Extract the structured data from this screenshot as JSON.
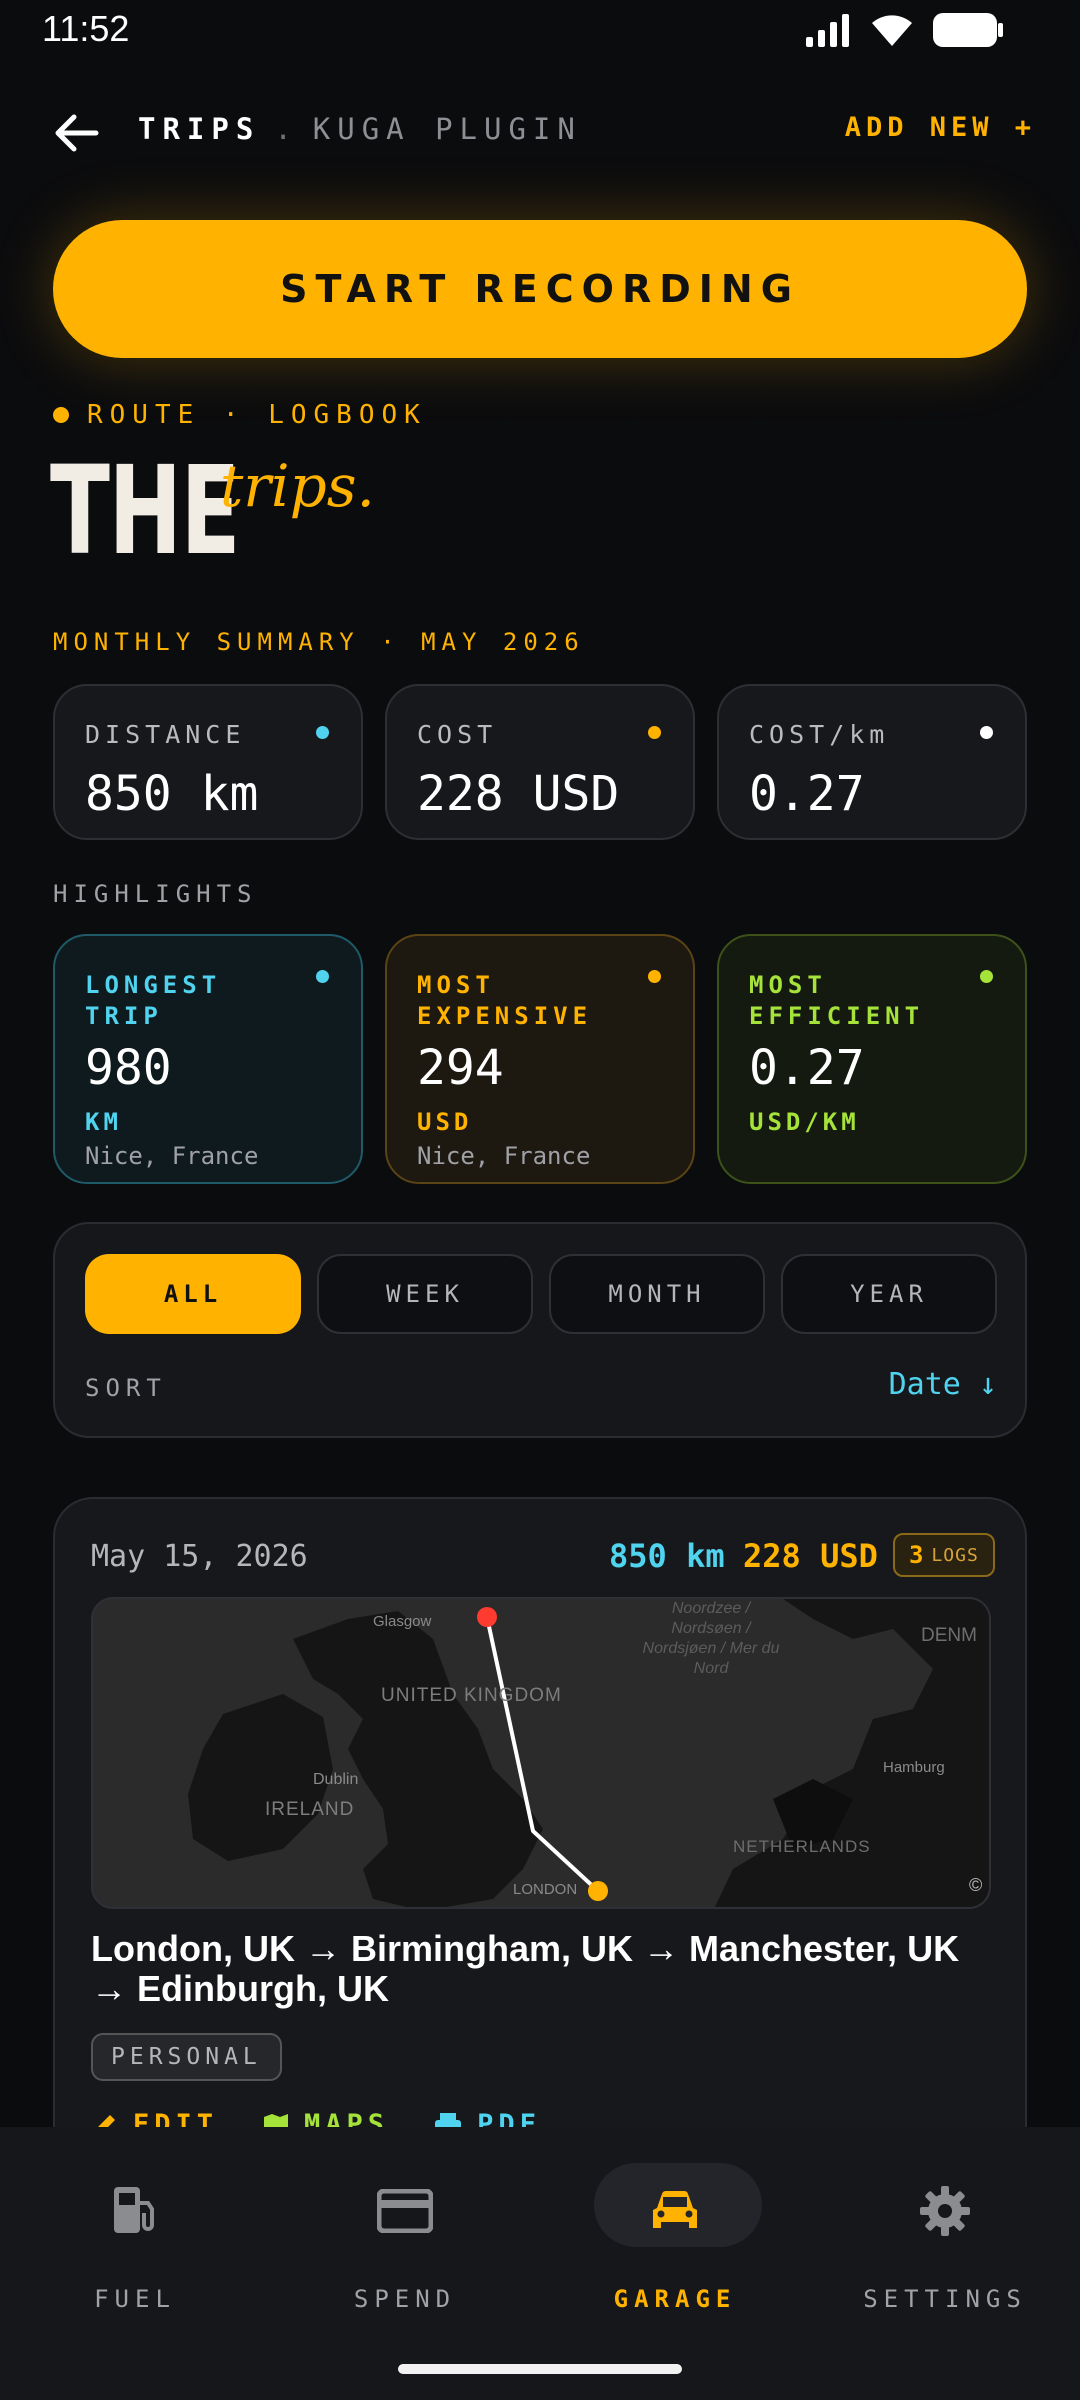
{
  "status": {
    "time": "11:52"
  },
  "header": {
    "title": "TRIPS",
    "separator": ".",
    "subtitle": "KUGA PLUGIN",
    "add_new": "ADD NEW +"
  },
  "start_button": "START RECORDING",
  "kicker": "ROUTE · LOGBOOK",
  "heading": {
    "big": "THE",
    "script": "trips."
  },
  "monthly_label": "MONTHLY SUMMARY · MAY 2026",
  "summary": [
    {
      "label": "DISTANCE",
      "value": "850 km",
      "dot": "#4fd3ee"
    },
    {
      "label": "COST",
      "value": "228 USD",
      "dot": "#ffb300"
    },
    {
      "label": "COST/km",
      "value": "0.27",
      "dot": "#ffffff"
    }
  ],
  "highlights_label": "HIGHLIGHTS",
  "highlights": [
    {
      "label": "LONGEST TRIP",
      "value": "980",
      "unit": "KM",
      "location": "Nice, France",
      "color": "#4fd3ee"
    },
    {
      "label": "MOST EXPENSIVE",
      "value": "294",
      "unit": "USD",
      "location": "Nice, France",
      "color": "#ffb300"
    },
    {
      "label": "MOST EFFICIENT",
      "value": "0.27",
      "unit": "USD/KM",
      "location": "",
      "color": "#a6e33a"
    }
  ],
  "filters": {
    "options": [
      "ALL",
      "WEEK",
      "MONTH",
      "YEAR"
    ],
    "selected": "ALL"
  },
  "sort": {
    "label": "SORT",
    "value": "Date ↓"
  },
  "trip": {
    "date": "May 15, 2026",
    "distance": "850 km",
    "cost": "228 USD",
    "logs_count": "3",
    "logs_label": "LOGS",
    "map_labels": {
      "glasgow": "Glasgow",
      "uk": "UNITED KINGDOM",
      "dublin": "Dublin",
      "ireland": "IRELAND",
      "london": "LONDON",
      "sea": "Noordzee / Nordsøen / Nordsjøen / Mer du Nord",
      "denmark": "DENM",
      "hamburg": "Hamburg",
      "netherlands": "NETHERLANDS",
      "copyright": "©"
    },
    "route": "London, UK → Birmingham, UK → Manchester, UK → Edinburgh, UK",
    "tag": "PERSONAL",
    "actions": [
      "EDIT",
      "MAPS",
      "PDF"
    ]
  },
  "nav": [
    {
      "label": "FUEL",
      "icon": "fuel-pump-icon"
    },
    {
      "label": "SPEND",
      "icon": "credit-card-icon"
    },
    {
      "label": "GARAGE",
      "icon": "car-icon"
    },
    {
      "label": "SETTINGS",
      "icon": "gear-icon"
    }
  ],
  "nav_active": "GARAGE"
}
